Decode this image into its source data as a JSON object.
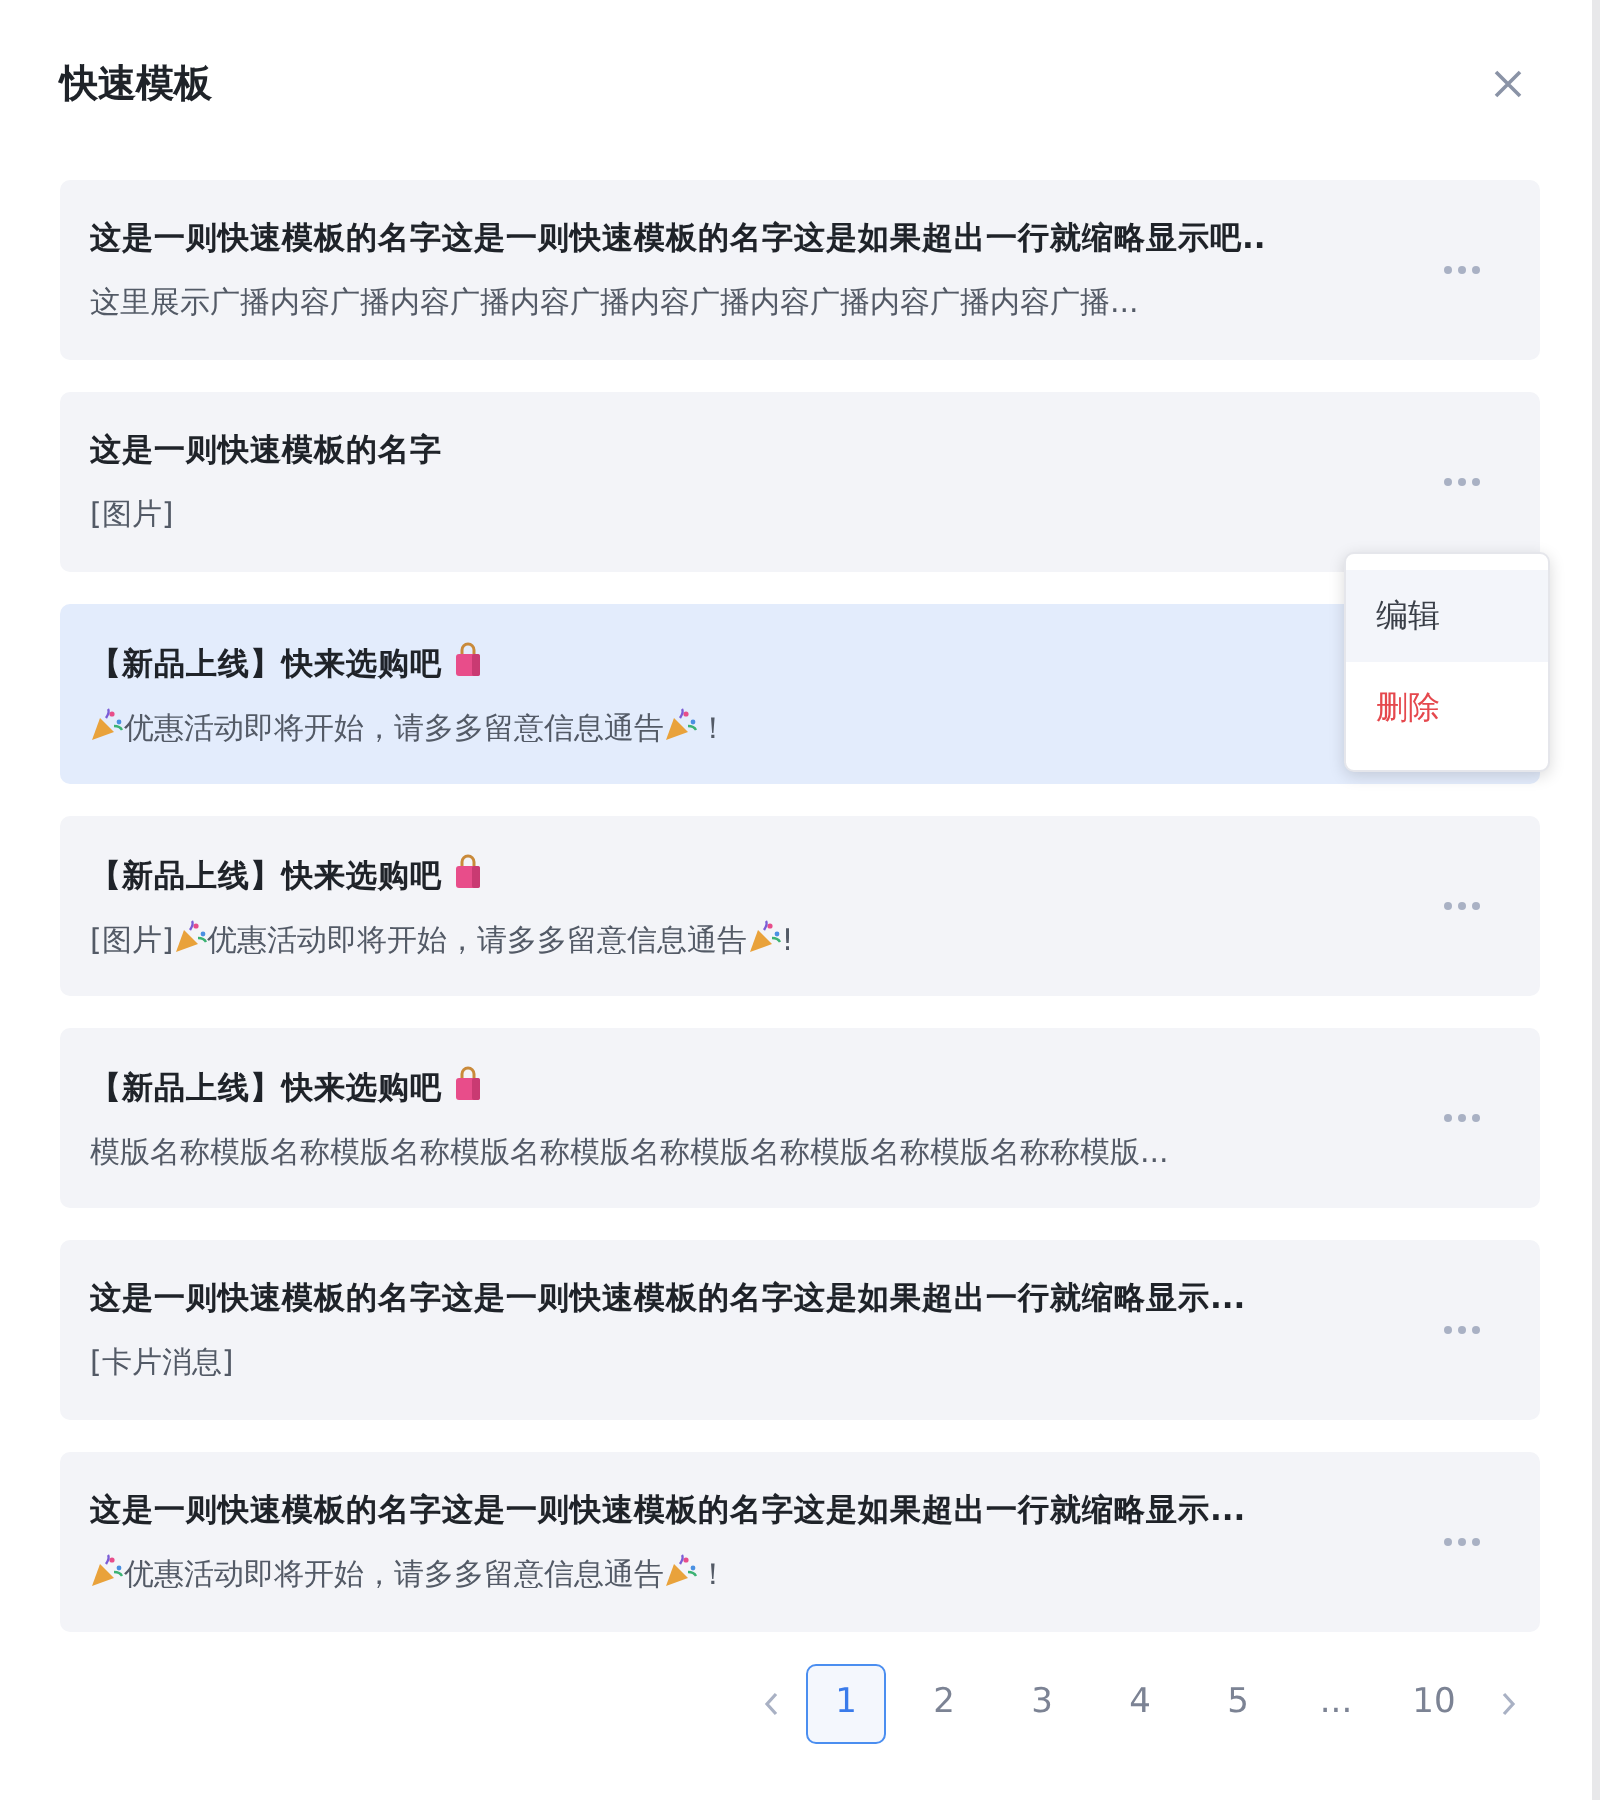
{
  "dialog": {
    "title": "快速模板"
  },
  "templates": [
    {
      "selected": false,
      "title": [
        {
          "kind": "text",
          "text": "这是一则快速模板的名字这是一则快速模板的名字这是如果超出一行就缩略显示吧.."
        }
      ],
      "content": [
        {
          "kind": "text",
          "text": "这里展示广播内容广播内容广播内容广播内容广播内容广播内容广播内容广播..."
        }
      ]
    },
    {
      "selected": false,
      "title": [
        {
          "kind": "text",
          "text": "这是一则快速模板的名字"
        }
      ],
      "content": [
        {
          "kind": "text",
          "text": "[图片]"
        }
      ]
    },
    {
      "selected": true,
      "title": [
        {
          "kind": "text",
          "text": "【新品上线】快来选购吧"
        },
        {
          "kind": "bag"
        }
      ],
      "content": [
        {
          "kind": "popper"
        },
        {
          "kind": "text",
          "text": "优惠活动即将开始，请多多留意信息通告"
        },
        {
          "kind": "popper"
        },
        {
          "kind": "text",
          "text": "！"
        }
      ],
      "menu": [
        {
          "label": "编辑",
          "kind": "normal",
          "selected": true
        },
        {
          "label": "删除",
          "kind": "danger",
          "selected": false
        }
      ]
    },
    {
      "selected": false,
      "title": [
        {
          "kind": "text",
          "text": "【新品上线】快来选购吧"
        },
        {
          "kind": "bag"
        }
      ],
      "content": [
        {
          "kind": "text",
          "text": "[图片]"
        },
        {
          "kind": "popper"
        },
        {
          "kind": "text",
          "text": "优惠活动即将开始，请多多留意信息通告"
        },
        {
          "kind": "popper"
        },
        {
          "kind": "text",
          "text": "!"
        }
      ]
    },
    {
      "selected": false,
      "title": [
        {
          "kind": "text",
          "text": "【新品上线】快来选购吧"
        },
        {
          "kind": "bag"
        }
      ],
      "content": [
        {
          "kind": "text",
          "text": "模版名称模版名称模版名称模版名称模版名称模版名称模版名称模版名称称模版..."
        }
      ]
    },
    {
      "selected": false,
      "title": [
        {
          "kind": "text",
          "text": "这是一则快速模板的名字这是一则快速模板的名字这是如果超出一行就缩略显示..."
        }
      ],
      "content": [
        {
          "kind": "text",
          "text": "[卡片消息]"
        }
      ]
    },
    {
      "selected": false,
      "title": [
        {
          "kind": "text",
          "text": "这是一则快速模板的名字这是一则快速模板的名字这是如果超出一行就缩略显示..."
        }
      ],
      "content": [
        {
          "kind": "popper"
        },
        {
          "kind": "text",
          "text": "优惠活动即将开始，请多多留意信息通告"
        },
        {
          "kind": "popper"
        },
        {
          "kind": "text",
          "text": "！"
        }
      ]
    }
  ],
  "pagination": {
    "pages": [
      {
        "label": "1",
        "selected": true
      },
      {
        "label": "2",
        "selected": false
      },
      {
        "label": "3",
        "selected": false
      },
      {
        "label": "4",
        "selected": false
      },
      {
        "label": "5",
        "selected": false
      },
      {
        "label": "...",
        "selected": false
      },
      {
        "label": "10",
        "selected": false
      }
    ]
  }
}
